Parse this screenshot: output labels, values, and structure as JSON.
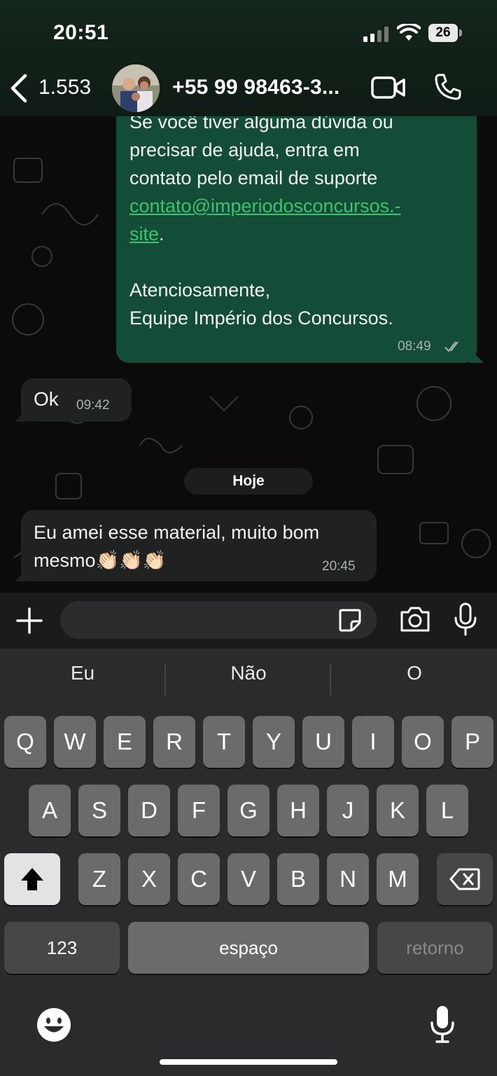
{
  "status_bar": {
    "time": "20:51",
    "battery": "26"
  },
  "header": {
    "back_count": "1.553",
    "contact_name": "+55 99 98463-3..."
  },
  "messages": {
    "outgoing_lines": [
      "Se você tiver alguma dúvida ou",
      "precisar de ajuda, entra em",
      "contato pelo email de suporte"
    ],
    "outgoing_link_1": "contato@imperiodosconcursos.-",
    "outgoing_link_2": "site",
    "outgoing_period": ".",
    "outgoing_signoff_1": "Atenciosamente,",
    "outgoing_signoff_2": "Equipe Império dos Concursos.",
    "outgoing_time": "08:49",
    "reply_ok": "Ok",
    "reply_ok_time": "09:42",
    "date_divider": "Hoje",
    "last_line_1": "Eu amei esse material, muito bom",
    "last_line_2": "mesmo👏🏻👏🏻👏🏻",
    "last_time": "20:45"
  },
  "input": {
    "placeholder": ""
  },
  "keyboard": {
    "suggestions": [
      "Eu",
      "Não",
      "O"
    ],
    "row1": [
      "Q",
      "W",
      "E",
      "R",
      "T",
      "Y",
      "U",
      "I",
      "O",
      "P"
    ],
    "row2": [
      "A",
      "S",
      "D",
      "F",
      "G",
      "H",
      "J",
      "K",
      "L"
    ],
    "row3": [
      "Z",
      "X",
      "C",
      "V",
      "B",
      "N",
      "M"
    ],
    "numbers_key": "123",
    "space_key": "espaço",
    "return_key": "retorno"
  },
  "colors": {
    "outgoing_bubble": "#144d37",
    "incoming_bubble": "#1f2221",
    "link": "#3dc26f"
  },
  "icons": [
    "back-icon",
    "video-call-icon",
    "phone-icon",
    "plus-icon",
    "sticker-icon",
    "camera-icon",
    "mic-icon",
    "shift-icon",
    "backspace-icon",
    "emoji-icon",
    "dictation-icon"
  ]
}
